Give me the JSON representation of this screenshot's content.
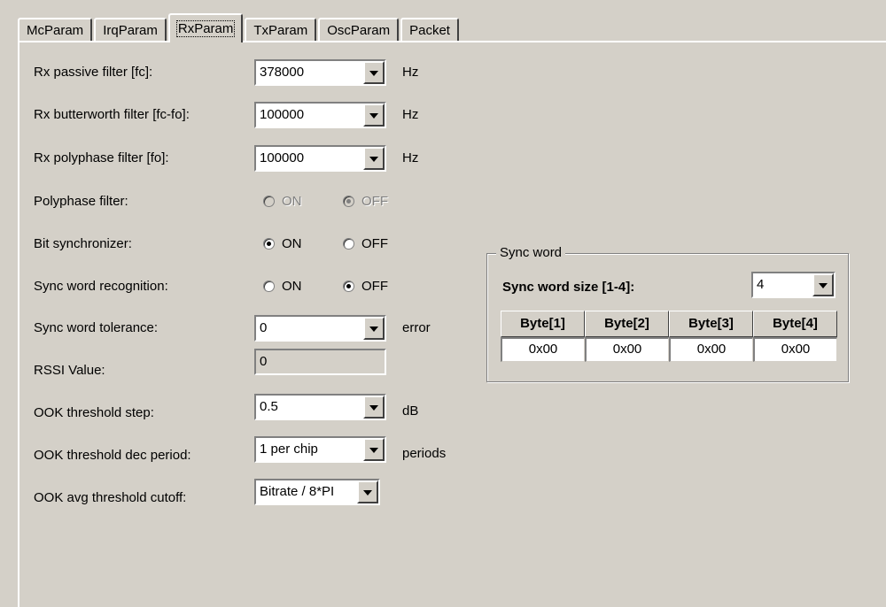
{
  "tabs": [
    "McParam",
    "IrqParam",
    "RxParam",
    "TxParam",
    "OscParam",
    "Packet"
  ],
  "active_tab": "RxParam",
  "fields": {
    "passive_filter": {
      "label": "Rx passive filter [fc]:",
      "value": "378000",
      "unit": "Hz"
    },
    "butterworth_filter": {
      "label": "Rx butterworth filter [fc-fo]:",
      "value": "100000",
      "unit": "Hz"
    },
    "polyphase_filter_freq": {
      "label": "Rx polyphase filter [fo]:",
      "value": "100000",
      "unit": "Hz"
    },
    "polyphase_filter": {
      "label": "Polyphase filter:",
      "on": "ON",
      "off": "OFF",
      "selected": "OFF",
      "disabled": true
    },
    "bit_synchronizer": {
      "label": "Bit synchronizer:",
      "on": "ON",
      "off": "OFF",
      "selected": "ON"
    },
    "sync_word_recognition": {
      "label": "Sync word recognition:",
      "on": "ON",
      "off": "OFF",
      "selected": "OFF"
    },
    "sync_word_tolerance": {
      "label": "Sync word tolerance:",
      "value": "0",
      "unit": "error"
    },
    "rssi": {
      "label": "RSSI Value:",
      "value": "0"
    },
    "ook_threshold_step": {
      "label": "OOK threshold step:",
      "value": "0.5",
      "unit": "dB"
    },
    "ook_threshold_dec_period": {
      "label": "OOK threshold dec period:",
      "value": "1 per chip",
      "unit": "periods"
    },
    "ook_avg_threshold_cutoff": {
      "label": "OOK avg threshold cutoff:",
      "value": "Bitrate / 8*PI"
    }
  },
  "sync_word": {
    "title": "Sync word",
    "size_label": "Sync word size [1-4]:",
    "size_value": "4",
    "headers": [
      "Byte[1]",
      "Byte[2]",
      "Byte[3]",
      "Byte[4]"
    ],
    "bytes": [
      "0x00",
      "0x00",
      "0x00",
      "0x00"
    ]
  }
}
